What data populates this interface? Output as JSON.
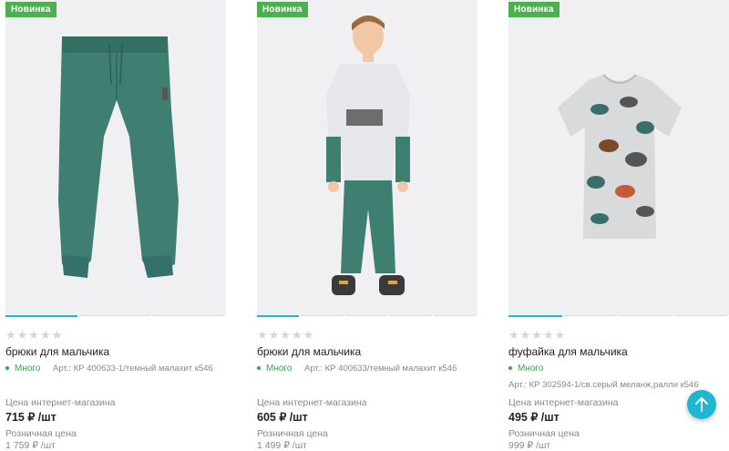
{
  "products": [
    {
      "badge": "Новинка",
      "stars": "★★★★★",
      "title": "брюки для мальчика",
      "stock": "Много",
      "article": "Арт.: КР 400633-1/темный малахит к546",
      "price_label": "Цена интернет-магазина",
      "price": "715 ₽ /шт",
      "retail_label": "Розничная цена",
      "retail_price": "1 759 ₽ /шт",
      "image_icon": "trousers-image"
    },
    {
      "badge": "Новинка",
      "stars": "★★★★★",
      "title": "брюки для мальчика",
      "stock": "Много",
      "article": "Арт.: КР 400633/темный малахит к546",
      "price_label": "Цена интернет-магазина",
      "price": "605 ₽ /шт",
      "retail_label": "Розничная цена",
      "retail_price": "1 499 ₽ /шт",
      "image_icon": "boy-model-image"
    },
    {
      "badge": "Новинка",
      "stars": "★★★★★",
      "title": "фуфайка для мальчика",
      "stock": "Много",
      "article": "Арт.: КР 302594-1/св.серый меланж,ралли к546",
      "price_label": "Цена интернет-магазина",
      "price": "495 ₽ /шт",
      "retail_label": "Розничная цена",
      "retail_price": "999 ₽ /шт",
      "image_icon": "tshirt-image"
    }
  ],
  "scroll_top_icon": "arrow-up-icon",
  "colors": {
    "badge": "#4caf50",
    "accent": "#1fb6d0",
    "stock": "#3aa64a",
    "muted": "#888888"
  }
}
